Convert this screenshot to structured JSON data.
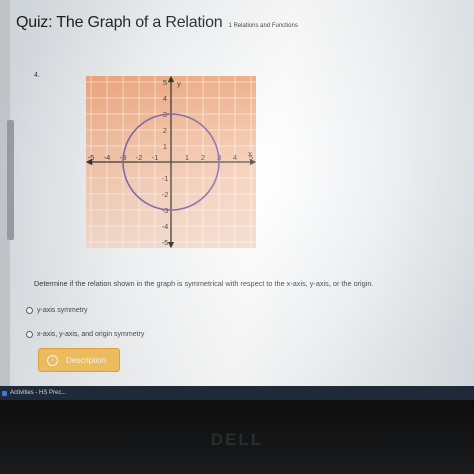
{
  "quiz": {
    "title": "Quiz: The Graph of a Relation",
    "subtitle": "1 Relations and Functions"
  },
  "question": {
    "number": "4.",
    "prompt": "Determine if the relation shown in the graph is symmetrical with respect to the x-axis, y-axis, or the origin."
  },
  "graph": {
    "x_axis_label": "x",
    "y_axis_label": "y",
    "x_ticks": [
      "-5",
      "-4",
      "-3",
      "-2",
      "-1",
      "1",
      "2",
      "3",
      "4",
      "5"
    ],
    "y_ticks": [
      "5",
      "4",
      "3",
      "2",
      "1",
      "-1",
      "-2",
      "-3",
      "-4",
      "-5"
    ],
    "circle_center": [
      0,
      0
    ],
    "circle_radius": 3,
    "colors": {
      "grid_top": "#f0a070",
      "grid_bottom": "#f6d9c8",
      "circle": "#6a4a9a"
    }
  },
  "options": [
    {
      "label": "y-axis symmetry"
    },
    {
      "label": "x-axis, y-axis, and origin symmetry"
    }
  ],
  "description_button": {
    "label": "Description",
    "icon": "info-icon"
  },
  "taskbar": {
    "label": "Activities - HS Prec..."
  },
  "monitor": {
    "brand": "DELL"
  }
}
